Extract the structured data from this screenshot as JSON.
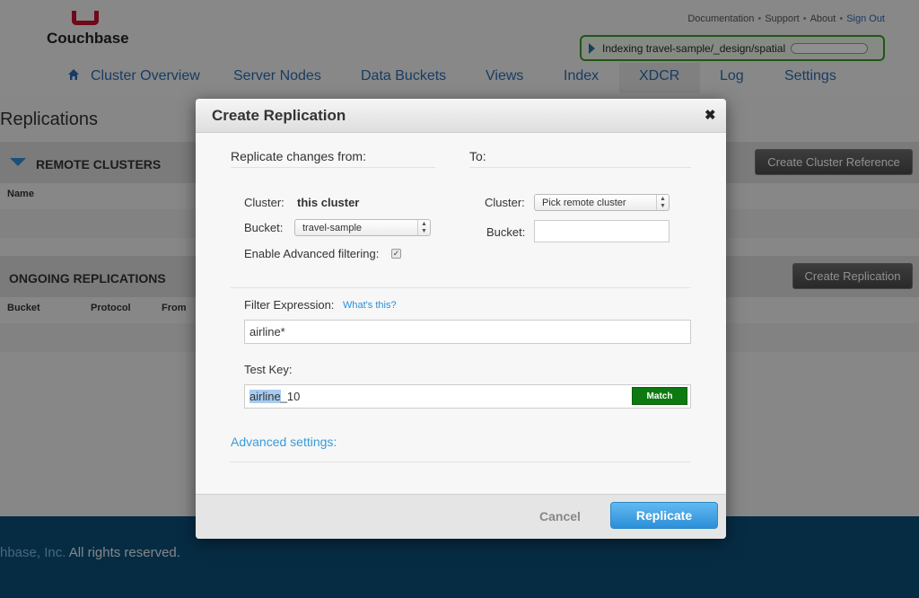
{
  "brand": {
    "name": "Couchbase",
    "logo_color": "#c8102e"
  },
  "top_links": {
    "documentation": "Documentation",
    "support": "Support",
    "about": "About",
    "sign_out": "Sign Out",
    "separator": "•"
  },
  "indexing": {
    "text": "Indexing travel-sample/_design/spatial",
    "progress": 0.0
  },
  "nav": {
    "items": [
      "Cluster Overview",
      "Server Nodes",
      "Data Buckets",
      "Views",
      "Index",
      "XDCR",
      "Log",
      "Settings"
    ],
    "active": "XDCR"
  },
  "page": {
    "title": "Replications",
    "remote_clusters": {
      "title": "REMOTE CLUSTERS",
      "button": "Create Cluster Reference",
      "col_name": "Name"
    },
    "ongoing": {
      "title": "ONGOING REPLICATIONS",
      "button": "Create Replication",
      "col_bucket": "Bucket",
      "col_protocol": "Protocol",
      "col_from": "From"
    }
  },
  "footer": {
    "brand": "hbase, Inc.",
    "rest": " All rights reserved."
  },
  "modal": {
    "title": "Create Replication",
    "close": "✖",
    "from_heading": "Replicate changes from:",
    "to_heading": "To:",
    "cluster_label": "Cluster:",
    "cluster_value": "this cluster",
    "bucket_label": "Bucket:",
    "bucket_value": "travel-sample",
    "advanced_filter_label": "Enable Advanced filtering:",
    "advanced_filter_checked": true,
    "remote_cluster_label": "Cluster:",
    "remote_cluster_value": "Pick remote cluster",
    "remote_bucket_label": "Bucket:",
    "remote_bucket_value": "",
    "filter_label": "Filter Expression:",
    "whats_this": "What's this?",
    "filter_value": "airline*",
    "test_key_label": "Test Key:",
    "test_key_match": "airline",
    "test_key_rest": "_10",
    "match_label": "Match",
    "advanced_settings": "Advanced settings:",
    "cancel": "Cancel",
    "replicate": "Replicate"
  },
  "colors": {
    "accent": "#2b8fd8",
    "match_green": "#0c7a10",
    "indexing_border": "#3a9a2a",
    "footer_bg": "#0b4f7a"
  }
}
